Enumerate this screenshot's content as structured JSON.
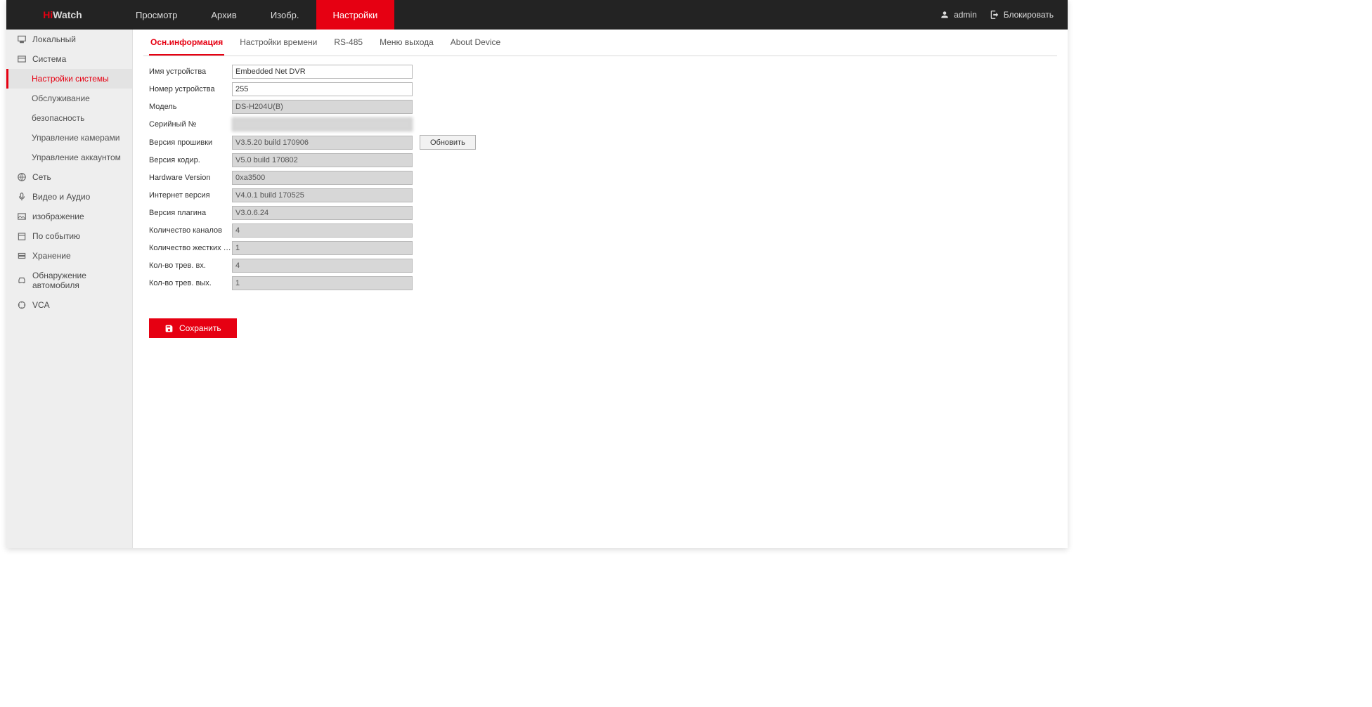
{
  "logo": {
    "prefix": "Hi",
    "suffix": "Watch"
  },
  "topnav": [
    {
      "label": "Просмотр",
      "active": false
    },
    {
      "label": "Архив",
      "active": false
    },
    {
      "label": "Изобр.",
      "active": false
    },
    {
      "label": "Настройки",
      "active": true
    }
  ],
  "topright": {
    "user": "admin",
    "lock": "Блокировать"
  },
  "sidebar": [
    {
      "type": "item",
      "icon": "monitor",
      "label": "Локальный"
    },
    {
      "type": "item",
      "icon": "system",
      "label": "Система"
    },
    {
      "type": "sub",
      "label": "Настройки системы",
      "active": true
    },
    {
      "type": "sub",
      "label": "Обслуживание"
    },
    {
      "type": "sub",
      "label": "безопасность"
    },
    {
      "type": "sub",
      "label": "Управление камерами"
    },
    {
      "type": "sub",
      "label": "Управление аккаунтом"
    },
    {
      "type": "item",
      "icon": "globe",
      "label": "Сеть"
    },
    {
      "type": "item",
      "icon": "mic",
      "label": "Видео и Аудио"
    },
    {
      "type": "item",
      "icon": "image",
      "label": "изображение"
    },
    {
      "type": "item",
      "icon": "calendar",
      "label": "По событию"
    },
    {
      "type": "item",
      "icon": "storage",
      "label": "Хранение"
    },
    {
      "type": "item",
      "icon": "car",
      "label": "Обнаружение автомобиля"
    },
    {
      "type": "item",
      "icon": "vca",
      "label": "VCA"
    }
  ],
  "tabs": [
    {
      "label": "Осн.информация",
      "active": true
    },
    {
      "label": "Настройки времени"
    },
    {
      "label": "RS-485"
    },
    {
      "label": "Меню выхода"
    },
    {
      "label": "About Device"
    }
  ],
  "fields": {
    "device_name": {
      "label": "Имя устройства",
      "value": "Embedded Net DVR",
      "readonly": false
    },
    "device_no": {
      "label": "Номер устройства",
      "value": "255",
      "readonly": false
    },
    "model": {
      "label": "Модель",
      "value": "DS-H204U(B)",
      "readonly": true
    },
    "serial": {
      "label": "Серийный №",
      "value": "",
      "readonly": true,
      "blurred": true
    },
    "firmware": {
      "label": "Версия прошивки",
      "value": "V3.5.20 build 170906",
      "readonly": true,
      "button": "Обновить"
    },
    "encoding": {
      "label": "Версия кодир.",
      "value": "V5.0 build 170802",
      "readonly": true
    },
    "hardware": {
      "label": "Hardware Version",
      "value": "0xa3500",
      "readonly": true
    },
    "web": {
      "label": "Интернет версия",
      "value": "V4.0.1 build 170525",
      "readonly": true
    },
    "plugin": {
      "label": "Версия плагина",
      "value": "V3.0.6.24",
      "readonly": true
    },
    "channels": {
      "label": "Количество каналов",
      "value": "4",
      "readonly": true
    },
    "hdds": {
      "label": "Количество жестких дис...",
      "value": "1",
      "readonly": true
    },
    "alarm_in": {
      "label": "Кол-во трев. вх.",
      "value": "4",
      "readonly": true
    },
    "alarm_out": {
      "label": "Кол-во трев. вых.",
      "value": "1",
      "readonly": true
    }
  },
  "buttons": {
    "save": "Сохранить"
  }
}
